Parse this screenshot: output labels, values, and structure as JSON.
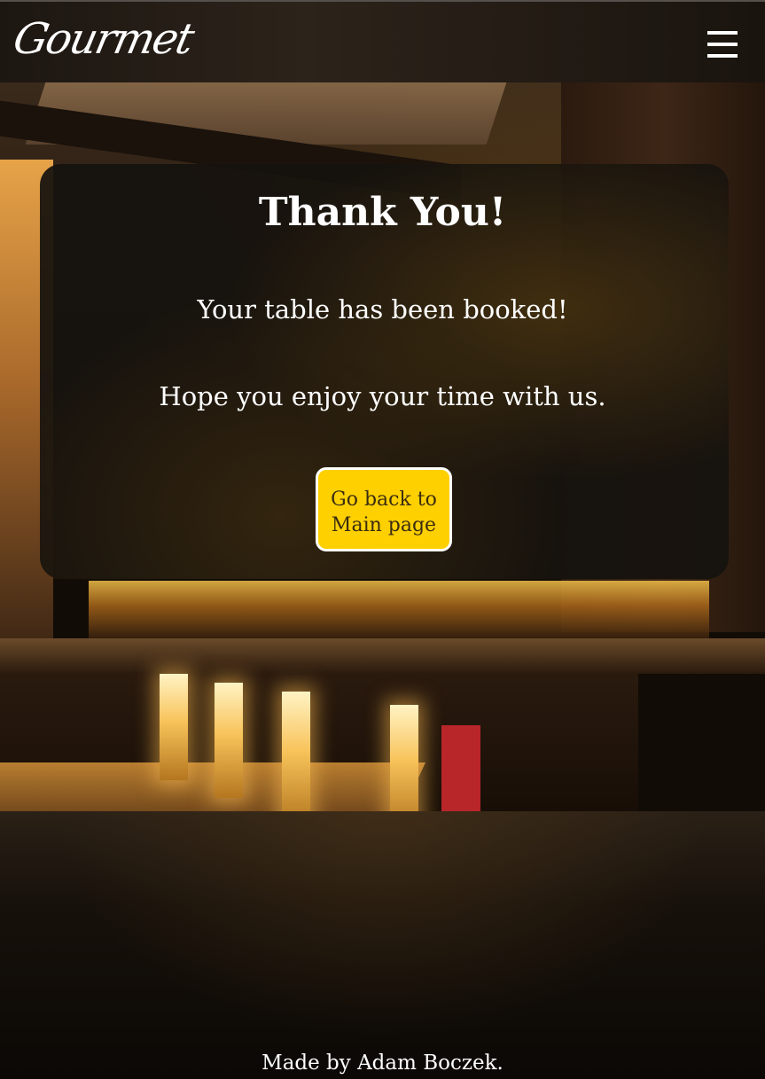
{
  "header": {
    "logo_text": "Gourmet",
    "menu_icon": "hamburger-menu-icon"
  },
  "card": {
    "title": "Thank You!",
    "message_booked": "Your table has been booked!",
    "message_enjoy": "Hope you enjoy your time with us.",
    "back_button_label": "Go back to Main page"
  },
  "footer": {
    "credit": "Made by Adam Boczek."
  },
  "colors": {
    "button_background": "#ffd000",
    "button_border": "#ffffff",
    "card_background": "#16120e",
    "text": "#ffffff"
  }
}
